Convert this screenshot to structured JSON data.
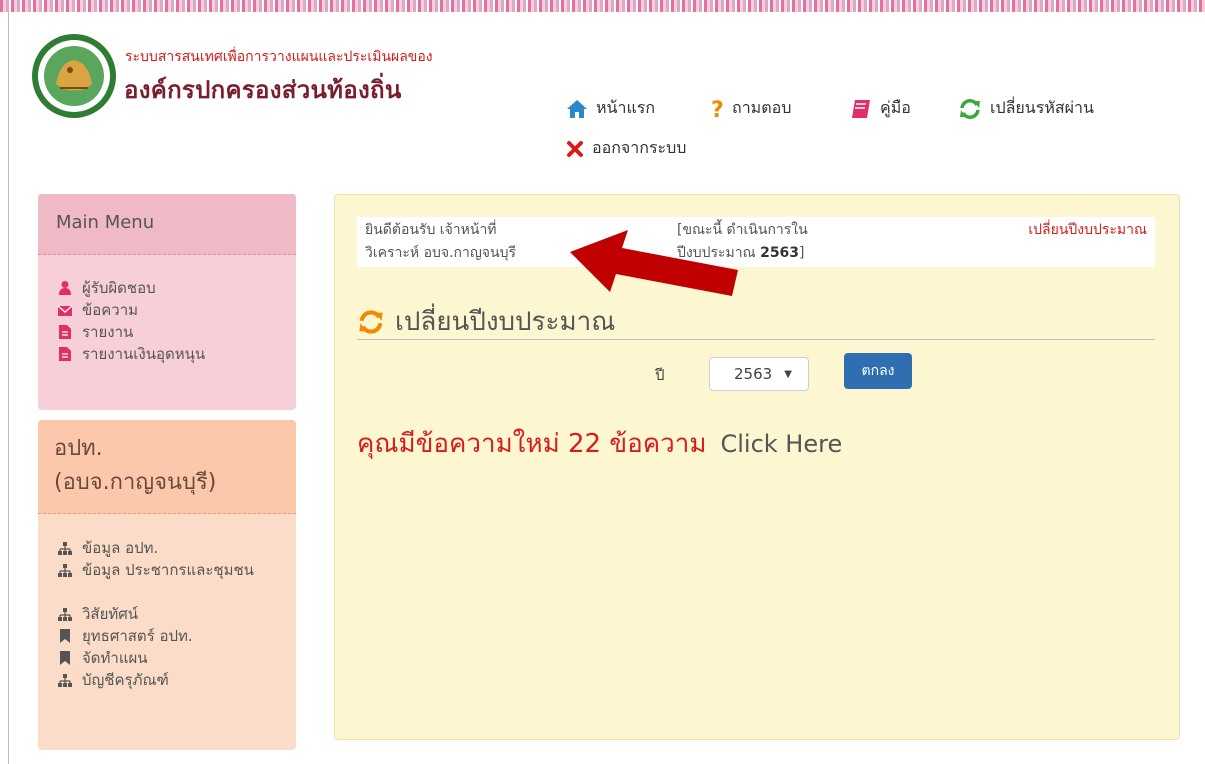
{
  "header": {
    "site_line1": "ระบบสารสนเทศเพื่อการวางแผนและประเมินผลของ",
    "site_line2": "องค์กรปกครองส่วนท้องถิ่น"
  },
  "nav": [
    {
      "label": "หน้าแรก",
      "icon": "home-icon"
    },
    {
      "label": "ถามตอบ",
      "icon": "question-icon"
    },
    {
      "label": "คู่มือ",
      "icon": "book-icon"
    },
    {
      "label": "เปลี่ยนรหัสผ่าน",
      "icon": "refresh-icon"
    },
    {
      "label": "ออกจากระบบ",
      "icon": "close-icon"
    }
  ],
  "sidebar": {
    "main_menu_title": "Main Menu",
    "main_menu_items": [
      {
        "label": "ผู้รับผิดชอบ",
        "icon": "user-icon"
      },
      {
        "label": "ข้อความ",
        "icon": "envelope-icon"
      },
      {
        "label": "รายงาน",
        "icon": "file-icon"
      },
      {
        "label": "รายงานเงินอุดหนุน",
        "icon": "file-icon"
      }
    ],
    "org_title_line1": "อปท.",
    "org_title_line2": "(อบจ.กาญจนบุรี)",
    "org_items": [
      {
        "label": "ข้อมูล อปท.",
        "icon": "sitemap-icon"
      },
      {
        "label": "ข้อมูล ประชากรและชุมชน",
        "icon": "sitemap-icon"
      },
      {
        "label": "วิสัยทัศน์",
        "icon": "sitemap-icon"
      },
      {
        "label": "ยุทธศาสตร์ อปท.",
        "icon": "bookmark-icon"
      },
      {
        "label": "จัดทำแผน",
        "icon": "bookmark-icon"
      },
      {
        "label": "บัญชีครุภัณฑ์",
        "icon": "sitemap-icon"
      }
    ]
  },
  "main": {
    "welcome_line1": "ยินดีต้อนรับ เจ้าหน้าที่",
    "welcome_line2": "วิเคราะห์ อบจ.กาญจนบุรี",
    "status_line1": "[ขณะนี้ ดำเนินการใน",
    "status_line2_prefix": "ปีงบประมาณ ",
    "status_year": "2563",
    "status_line2_suffix": "]",
    "change_year_link": "เปลี่ยนปีงบประมาณ",
    "section_title": "เปลี่ยนปีงบประมาณ",
    "year_label": "ปี",
    "year_selected": "2563",
    "ok_button": "ตกลง",
    "new_message_text": "คุณมีข้อความใหม่ 22 ข้อความ",
    "click_here": "Click Here"
  },
  "colors": {
    "accent_red": "#d81b1b",
    "button_blue": "#2f6fb1",
    "panel_yellow": "#fcf7d0",
    "sidebar_pink": "#f6cfd9",
    "sidebar_orange": "#fbdcc8",
    "arrow_red": "#c00000"
  }
}
